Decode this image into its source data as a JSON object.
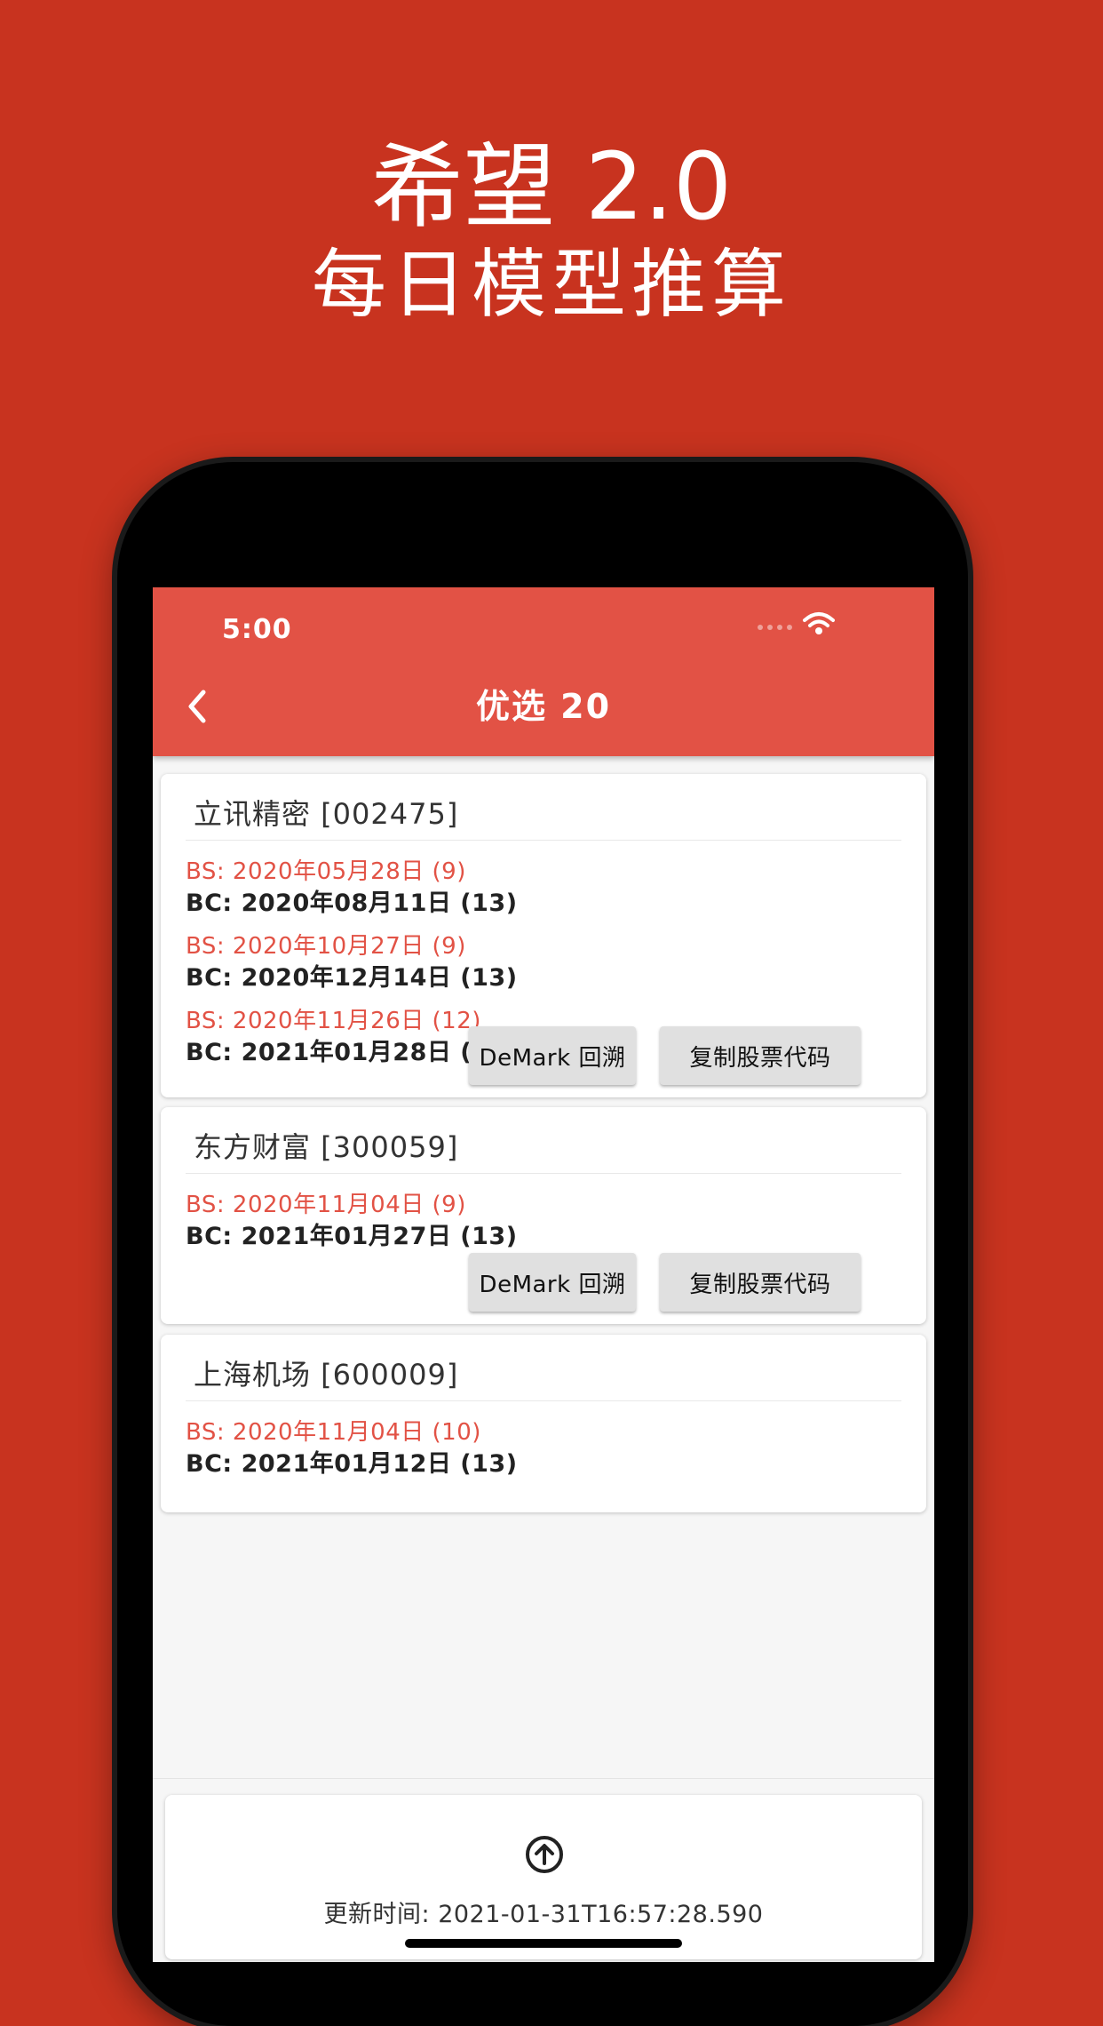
{
  "promo": {
    "title": "希望 2.0",
    "subtitle": "每日模型推算"
  },
  "status_bar": {
    "time": "5:00"
  },
  "appbar": {
    "title": "优选 20"
  },
  "cards": [
    {
      "title": "立讯精密 [002475]",
      "signals": [
        {
          "bs": "BS: 2020年05月28日 (9)",
          "bc": "BC: 2020年08月11日 (13)"
        },
        {
          "bs": "BS: 2020年10月27日 (9)",
          "bc": "BC: 2020年12月14日 (13)"
        },
        {
          "bs": "BS: 2020年11月26日 (12)",
          "bc": "BC: 2021年01月28日 (13)"
        }
      ],
      "demark_label": "DeMark 回溯",
      "copy_label": "复制股票代码"
    },
    {
      "title": "东方财富 [300059]",
      "signals": [
        {
          "bs": "BS: 2020年11月04日 (9)",
          "bc": "BC: 2021年01月27日 (13)"
        }
      ],
      "demark_label": "DeMark 回溯",
      "copy_label": "复制股票代码"
    },
    {
      "title": "上海机场 [600009]",
      "signals": [
        {
          "bs": "BS: 2020年11月04日 (10)",
          "bc": "BC: 2021年01月12日 (13)"
        }
      ]
    }
  ],
  "footer": {
    "update_text": "更新时间: 2021-01-31T16:57:28.590"
  },
  "colors": {
    "background": "#c8331f",
    "appbar": "#e25245",
    "bs_text": "#e25245",
    "button": "#e0e0e0"
  },
  "icons": {
    "back": "chevron-left-icon",
    "wifi": "wifi-icon",
    "signal": "cellular-signal-icon",
    "upload": "arrow-up-circle-icon"
  }
}
